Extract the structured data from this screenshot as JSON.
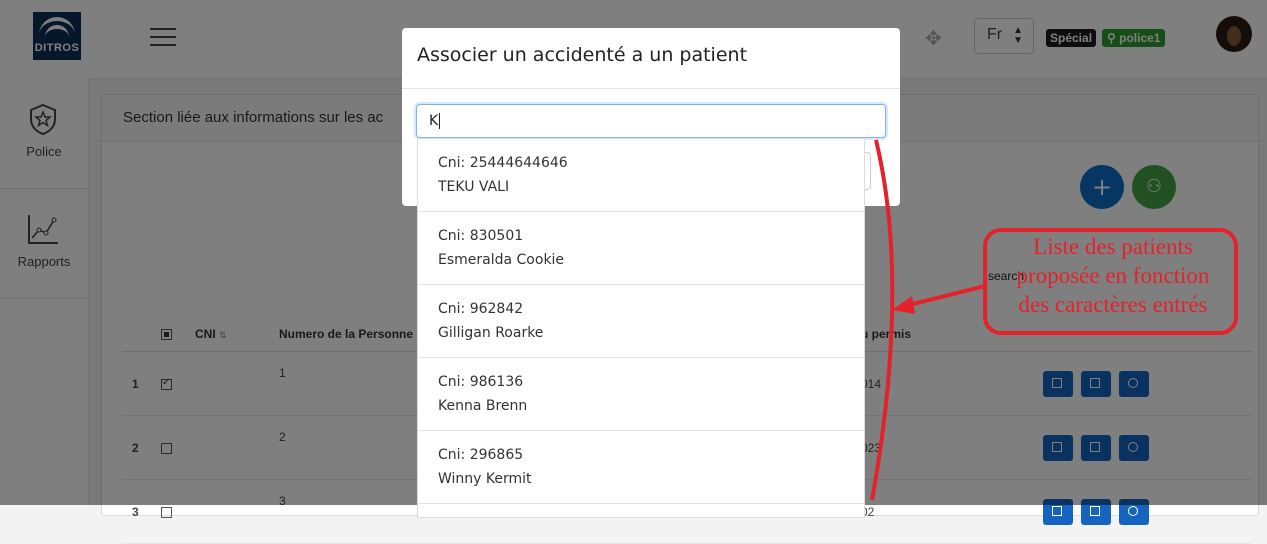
{
  "app": {
    "logo_text": "DITROS"
  },
  "header": {
    "language": "Fr",
    "role_badge": "Spécial",
    "user_badge": "police1"
  },
  "sidebar": {
    "items": [
      {
        "label": "Police",
        "icon": "shield-star-icon"
      },
      {
        "label": "Rapports",
        "icon": "line-chart-icon"
      }
    ]
  },
  "panel": {
    "title": "Section liée aux informations sur les ac",
    "search_label": "search",
    "table": {
      "headers": [
        "CNI",
        "Numero de la Personne",
        "u permis"
      ],
      "rows": [
        {
          "index": "1",
          "checked": true,
          "numero": "1",
          "permis": "014"
        },
        {
          "index": "2",
          "checked": false,
          "numero": "2",
          "permis": "023"
        },
        {
          "index": "3",
          "checked": false,
          "numero": "3",
          "permis": "02"
        }
      ]
    }
  },
  "modal": {
    "title": "Associer un accidenté a un patient",
    "search_value": "K"
  },
  "suggestions": [
    {
      "cni": "Cni: 25444644646",
      "name": "TEKU VALI"
    },
    {
      "cni": "Cni: 830501",
      "name": "Esmeralda Cookie"
    },
    {
      "cni": "Cni: 962842",
      "name": "Gilligan Roarke"
    },
    {
      "cni": "Cni: 986136",
      "name": "Kenna Brenn"
    },
    {
      "cni": "Cni: 296865",
      "name": "Winny Kermit"
    }
  ],
  "annotation": {
    "lines": [
      "Liste des patients",
      "proposée en fonction",
      "des caractères entrés"
    ],
    "color": "#e3222a"
  }
}
